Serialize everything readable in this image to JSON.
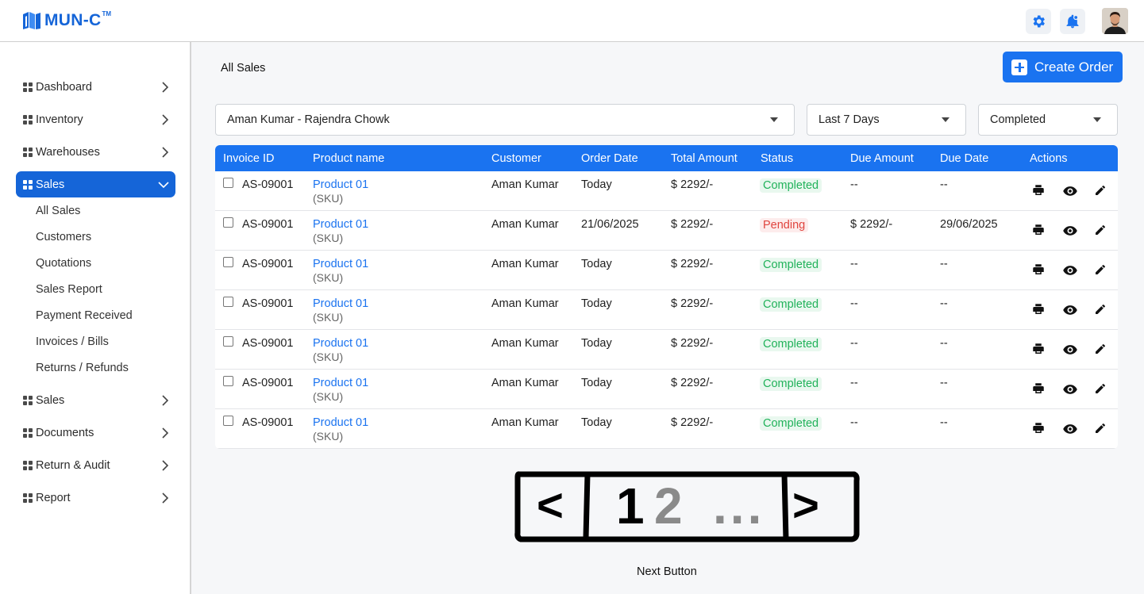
{
  "header": {
    "logo_text": "MUN-C",
    "logo_tm": "TM",
    "settings_icon": "gear-icon",
    "notifications_icon": "bell-icon",
    "accent_color": "#1565d8"
  },
  "sidebar": {
    "items": [
      {
        "label": "Dashboard"
      },
      {
        "label": "Inventory"
      },
      {
        "label": "Warehouses"
      },
      {
        "label": "Sales"
      },
      {
        "label": "Sales"
      },
      {
        "label": "Documents"
      },
      {
        "label": "Return & Audit"
      },
      {
        "label": "Report"
      }
    ],
    "sales_sub_items": [
      "All Sales",
      "Customers",
      "Quotations",
      "Sales Report",
      "Payment Received",
      "Invoices / Bills",
      "Returns / Refunds"
    ]
  },
  "main": {
    "title": "All Sales",
    "create_button": "Create Order",
    "filters": {
      "customer": "Aman Kumar - Rajendra Chowk",
      "period": "Last 7 Days",
      "status": "Completed"
    },
    "table": {
      "columns": [
        "Invoice ID",
        "Product name",
        "Customer",
        "Order Date",
        "Total Amount",
        "Status",
        "Due Amount",
        "Due Date",
        "Actions"
      ],
      "rows": [
        {
          "invoice": "AS-09001",
          "product": "Product 01",
          "sku": "(SKU)",
          "customer": "Aman Kumar",
          "order_date": "Today",
          "total": "$ 2292/-",
          "status": "Completed",
          "due_amount": "--",
          "due_date": "--"
        },
        {
          "invoice": "AS-09001",
          "product": "Product 01",
          "sku": "(SKU)",
          "customer": "Aman Kumar",
          "order_date": "21/06/2025",
          "total": "$ 2292/-",
          "status": "Pending",
          "due_amount": "$ 2292/-",
          "due_date": "29/06/2025"
        },
        {
          "invoice": "AS-09001",
          "product": "Product 01",
          "sku": "(SKU)",
          "customer": "Aman Kumar",
          "order_date": "Today",
          "total": "$ 2292/-",
          "status": "Completed",
          "due_amount": "--",
          "due_date": "--"
        },
        {
          "invoice": "AS-09001",
          "product": "Product 01",
          "sku": "(SKU)",
          "customer": "Aman Kumar",
          "order_date": "Today",
          "total": "$ 2292/-",
          "status": "Completed",
          "due_amount": "--",
          "due_date": "--"
        },
        {
          "invoice": "AS-09001",
          "product": "Product 01",
          "sku": "(SKU)",
          "customer": "Aman Kumar",
          "order_date": "Today",
          "total": "$ 2292/-",
          "status": "Completed",
          "due_amount": "--",
          "due_date": "--"
        },
        {
          "invoice": "AS-09001",
          "product": "Product 01",
          "sku": "(SKU)",
          "customer": "Aman Kumar",
          "order_date": "Today",
          "total": "$ 2292/-",
          "status": "Completed",
          "due_amount": "--",
          "due_date": "--"
        },
        {
          "invoice": "AS-09001",
          "product": "Product 01",
          "sku": "(SKU)",
          "customer": "Aman Kumar",
          "order_date": "Today",
          "total": "$ 2292/-",
          "status": "Completed",
          "due_amount": "--",
          "due_date": "--"
        }
      ],
      "action_icons": [
        "printer-icon",
        "eye-icon",
        "pencil-icon"
      ]
    },
    "pagination": {
      "prev": "<",
      "page_1": "1",
      "page_2": "2",
      "ellipsis": "...",
      "next": ">",
      "caption": "Next Button"
    }
  }
}
